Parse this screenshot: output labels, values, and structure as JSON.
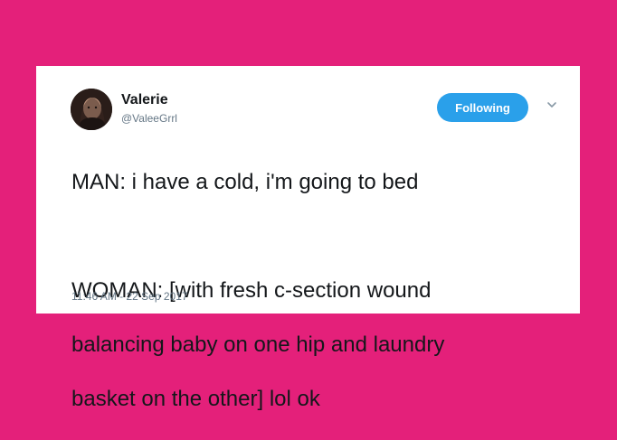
{
  "tweet": {
    "user": {
      "display_name": "Valerie",
      "handle": "@ValeeGrrl"
    },
    "follow_button_label": "Following",
    "text_lines": [
      "MAN: i have a cold, i'm going to bed",
      "",
      "WOMAN: [with fresh c-section wound",
      "balancing baby on one hip and laundry",
      "basket on the other] lol ok"
    ],
    "timestamp": "11:46 AM - 22 Sep 2017"
  },
  "icons": {
    "avatar": "avatar-photo",
    "menu": "chevron-down-icon"
  },
  "colors": {
    "background": "#e4207a",
    "card": "#ffffff",
    "accent": "#2aa0ea",
    "text": "#14171a",
    "muted": "#657786"
  }
}
